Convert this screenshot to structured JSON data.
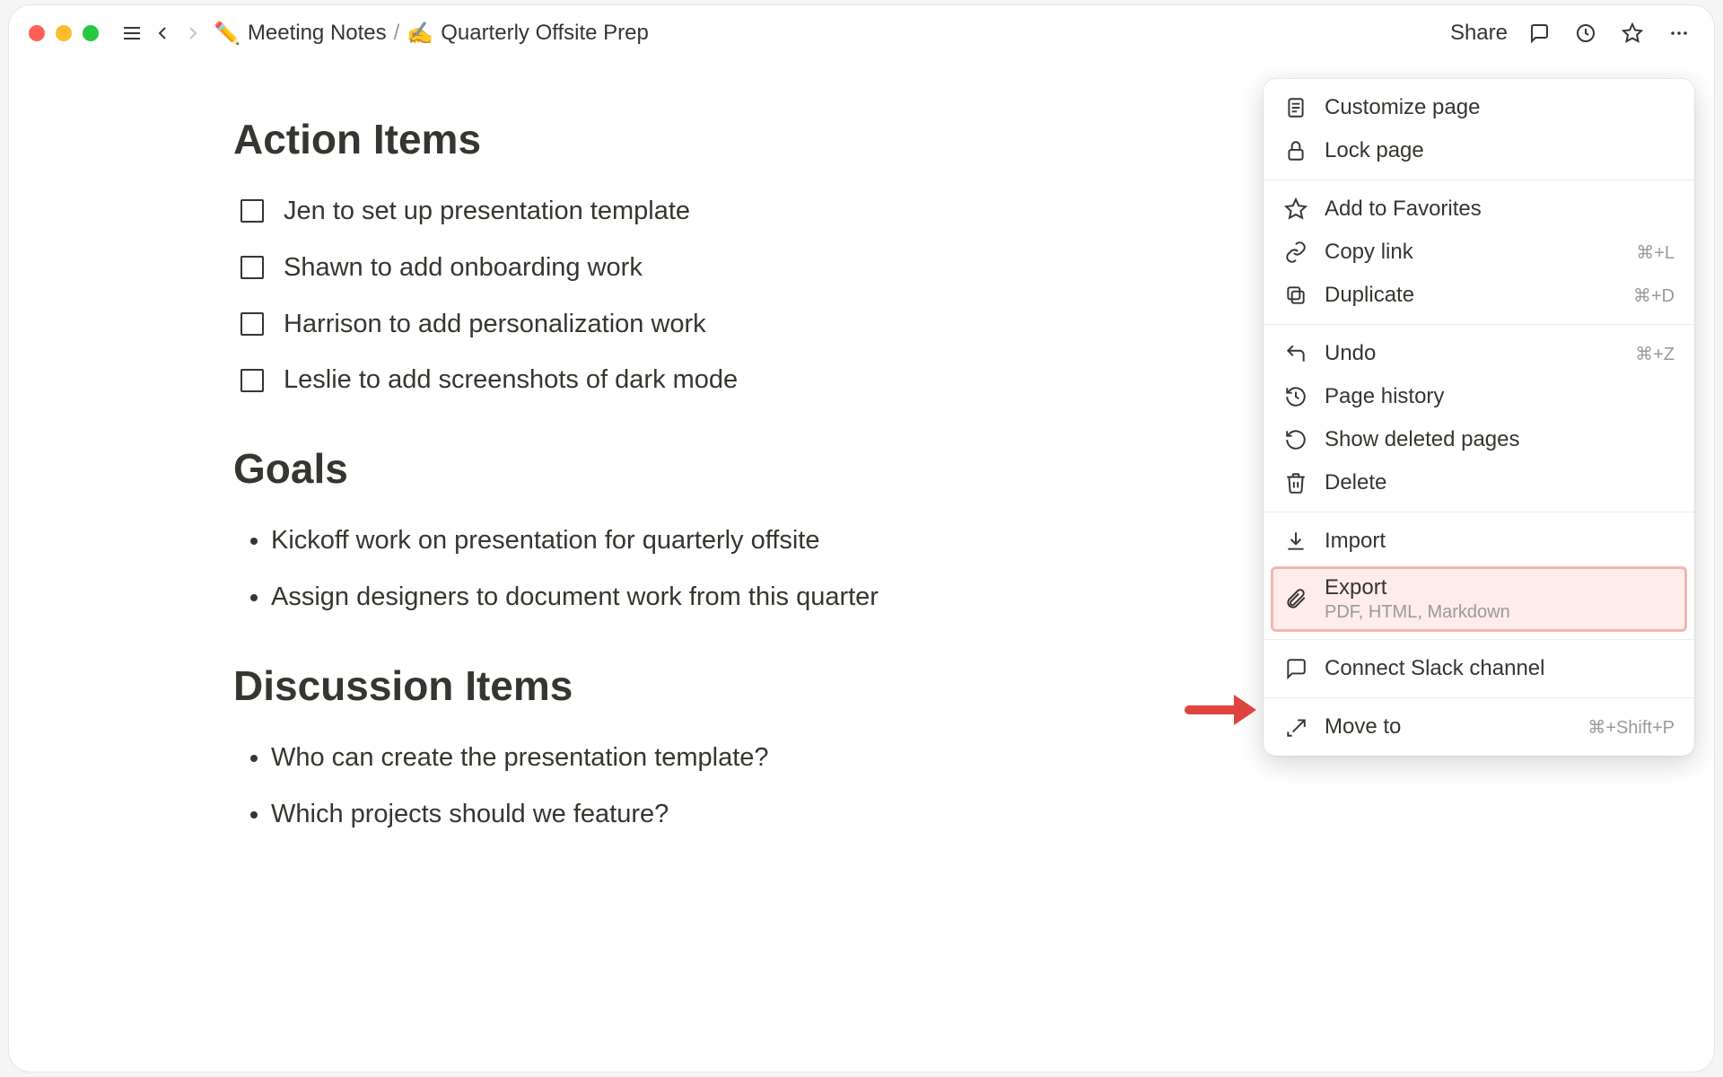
{
  "topbar": {
    "share": "Share",
    "breadcrumb": [
      {
        "emoji": "✏️",
        "label": "Meeting Notes"
      },
      {
        "emoji": "✍️",
        "label": "Quarterly Offsite Prep"
      }
    ]
  },
  "sections": {
    "action_items": {
      "title": "Action Items",
      "items": [
        "Jen to set up presentation template",
        "Shawn to add onboarding work",
        "Harrison to add personalization work",
        "Leslie to add screenshots of dark mode"
      ]
    },
    "goals": {
      "title": "Goals",
      "items": [
        "Kickoff work on presentation for quarterly offsite",
        "Assign designers to document work from this quarter"
      ]
    },
    "discussion": {
      "title": "Discussion Items",
      "items": [
        "Who can create the presentation template?",
        "Which projects should we feature?"
      ]
    }
  },
  "menu": {
    "customize": "Customize page",
    "lock": "Lock page",
    "favorites": "Add to Favorites",
    "copy_link": {
      "label": "Copy link",
      "shortcut": "⌘+L"
    },
    "duplicate": {
      "label": "Duplicate",
      "shortcut": "⌘+D"
    },
    "undo": {
      "label": "Undo",
      "shortcut": "⌘+Z"
    },
    "page_history": "Page history",
    "show_deleted": "Show deleted pages",
    "delete": "Delete",
    "import": "Import",
    "export": {
      "label": "Export",
      "sub": "PDF, HTML, Markdown"
    },
    "connect_slack": "Connect Slack channel",
    "move_to": {
      "label": "Move to",
      "shortcut": "⌘+Shift+P"
    }
  }
}
